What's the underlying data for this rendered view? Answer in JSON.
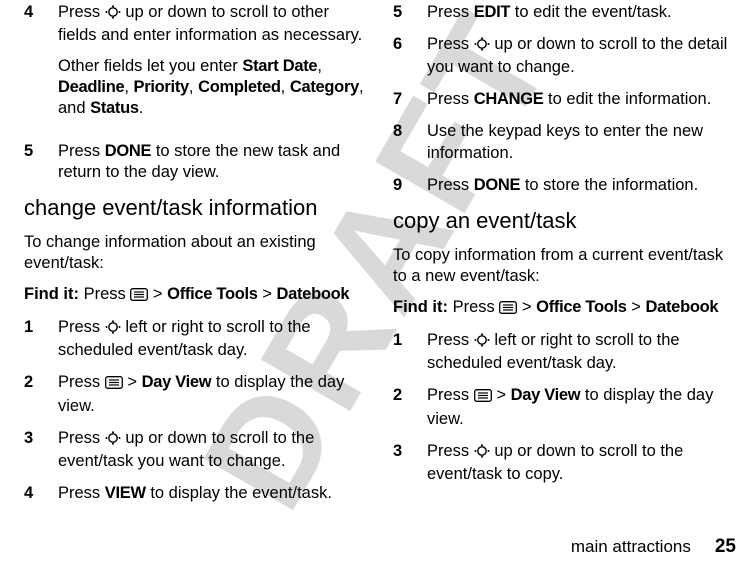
{
  "watermark": "DRAFT",
  "footer": {
    "label": "main attractions",
    "page": "25"
  },
  "left": {
    "step4": {
      "num": "4",
      "text_a": "Press ",
      "text_b": " up or down to scroll to other fields and enter information as necessary.",
      "para2_a": "Other fields let you enter ",
      "sd": "Start Date",
      "c1": ", ",
      "dl": "Deadline",
      "c2": ", ",
      "pr": "Priority",
      "c3": ", ",
      "cp": "Completed",
      "c4": ", ",
      "cat": "Category",
      "c5": ", and ",
      "st": "Status",
      "c6": "."
    },
    "step5": {
      "num": "5",
      "a": "Press ",
      "done": "DONE",
      "b": " to store the new task and return to the day view."
    },
    "heading": "change event/task information",
    "intro": "To change information about an existing event/task:",
    "findit": {
      "label": "Find it:",
      "a": " Press ",
      "gt1": " > ",
      "ot": "Office Tools",
      "gt2": " > ",
      "db": "Datebook"
    },
    "s1": {
      "num": "1",
      "a": "Press ",
      "b": " left or right to scroll to the scheduled event/task day."
    },
    "s2": {
      "num": "2",
      "a": "Press ",
      "gt": " > ",
      "dv": "Day View",
      "b": " to display the day view."
    },
    "s3": {
      "num": "3",
      "a": "Press ",
      "b": " up or down to scroll to the event/task you want to change."
    },
    "s4": {
      "num": "4",
      "a": "Press ",
      "view": "VIEW",
      "b": " to display the event/task."
    }
  },
  "right": {
    "s5": {
      "num": "5",
      "a": "Press ",
      "edit": "EDIT",
      "b": " to edit the event/task."
    },
    "s6": {
      "num": "6",
      "a": "Press ",
      "b": " up or down to scroll to the detail you want to change."
    },
    "s7": {
      "num": "7",
      "a": "Press ",
      "change": "CHANGE",
      "b": " to edit the information."
    },
    "s8": {
      "num": "8",
      "a": "Use the keypad keys to enter the new information."
    },
    "s9": {
      "num": "9",
      "a": "Press ",
      "done": "DONE",
      "b": " to store the information."
    },
    "heading": "copy an event/task",
    "intro": "To copy information from a current event/task to a new event/task:",
    "findit": {
      "label": "Find it:",
      "a": " Press ",
      "gt1": " > ",
      "ot": "Office Tools",
      "gt2": " > ",
      "db": "Datebook"
    },
    "c1": {
      "num": "1",
      "a": "Press ",
      "b": " left or right to scroll to the scheduled event/task day."
    },
    "c2": {
      "num": "2",
      "a": "Press ",
      "gt": " > ",
      "dv": "Day View",
      "b": " to display the day view."
    },
    "c3": {
      "num": "3",
      "a": "Press ",
      "b": " up or down to scroll to the event/task to copy."
    }
  }
}
